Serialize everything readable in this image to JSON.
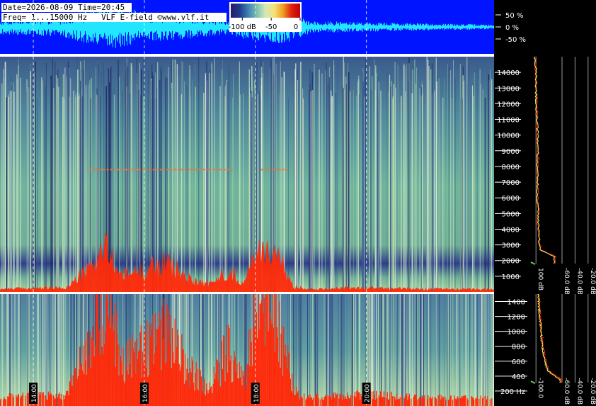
{
  "header": {
    "date_line": "Date=2026-08-09 Time=20:45",
    "freq_line": "Freq= 1...15000 Hz   VLF E-field ©www.vlf.it"
  },
  "colorbar": {
    "ticks": [
      {
        "value": -100,
        "label": "-100 dB"
      },
      {
        "value": -50,
        "label": "-50"
      },
      {
        "value": 0,
        "label": "0"
      }
    ],
    "range_db": [
      -120,
      0
    ],
    "colors": [
      "#2a1a6e",
      "#1c3a8a",
      "#3f7fb5",
      "#7cc0b0",
      "#d4e8b8",
      "#f3e27a",
      "#f0a020",
      "#e02010",
      "#c00000"
    ]
  },
  "colors": {
    "waveform_bg": "#0014ff",
    "waveform_trace": "#22e6ff",
    "burst": "#ff2a0a",
    "grid": "#ffffff",
    "spectrum_red": "#ff2a0a",
    "spectrum_yellow": "#f4f060",
    "spectrum_green": "#5ad250"
  },
  "chart_data": [
    {
      "type": "area",
      "name": "waveform",
      "ylabel_ticks": [
        "50 %",
        "0 %",
        "-50 %"
      ],
      "y_ticks_values": [
        50,
        0,
        -50
      ],
      "ylim": [
        -100,
        100
      ],
      "xlim": [
        13.4,
        22.3
      ],
      "envelope_x": [
        13.4,
        14.5,
        15.0,
        15.5,
        16.0,
        16.5,
        17.0,
        17.5,
        18.0,
        18.5,
        19.0,
        20.0,
        21.0,
        22.3
      ],
      "envelope_pct": [
        30,
        40,
        75,
        90,
        60,
        55,
        45,
        30,
        65,
        70,
        25,
        20,
        15,
        10
      ]
    },
    {
      "type": "heatmap",
      "name": "spectrogram-full",
      "yunit": "Hz",
      "ylim": [
        0,
        15000
      ],
      "y_ticks": [
        1000,
        2000,
        3000,
        4000,
        5000,
        6000,
        7000,
        8000,
        9000,
        10000,
        11000,
        12000,
        13000,
        14000
      ],
      "xlim": [
        13.4,
        22.3
      ],
      "time_markers": [
        {
          "x": 14.0,
          "label": "14:00"
        },
        {
          "x": 16.0,
          "label": "16:00"
        },
        {
          "x": 18.0,
          "label": "18:00"
        },
        {
          "x": 20.0,
          "label": "20:00"
        }
      ],
      "burst_profile_x": [
        13.4,
        14.6,
        15.0,
        15.3,
        15.6,
        16.0,
        16.4,
        16.8,
        17.2,
        17.5,
        17.8,
        18.0,
        18.3,
        18.7,
        19.0,
        20.0,
        21.0,
        22.3
      ],
      "burst_profile_hz": [
        300,
        400,
        2200,
        4300,
        1500,
        2200,
        2800,
        1300,
        700,
        2100,
        800,
        4200,
        4000,
        500,
        300,
        400,
        300,
        250
      ],
      "carrier_lines": [
        {
          "from": 15.0,
          "to": 17.6,
          "freq_hz": 7800
        },
        {
          "from": 18.1,
          "to": 18.6,
          "freq_hz": 7800
        }
      ]
    },
    {
      "type": "heatmap",
      "name": "spectrogram-low",
      "yunit": "Hz",
      "ylim": [
        0,
        1500
      ],
      "y_ticks": [
        200,
        400,
        600,
        800,
        1000,
        1200,
        1400
      ],
      "y_tick_labels": [
        "200 Hz",
        "400",
        "600",
        "800",
        "1000",
        "1200",
        "1400"
      ],
      "xlim": [
        13.4,
        22.3
      ]
    },
    {
      "type": "line",
      "name": "spectrum-full",
      "x_ticks": [
        -100,
        -60,
        -40,
        -20
      ],
      "x_tick_labels": [
        "100 dB",
        "-60.0 dB",
        "-40.0 dB",
        "-20.0 dB"
      ],
      "xlim": [
        -110,
        -10
      ],
      "ylim": [
        0,
        15000
      ],
      "series": [
        {
          "color": "red",
          "freq_hz": [
            500,
            1000,
            1500,
            2000,
            3000,
            4000,
            5000,
            6000,
            7000,
            8000,
            9000,
            10000,
            11000,
            12000,
            13000,
            14000,
            15000
          ],
          "db": [
            -70,
            -92,
            -94,
            -96,
            -97,
            -96,
            -97,
            -98,
            -97,
            -96,
            -98,
            -99,
            -98,
            -99,
            -100,
            -101,
            -101
          ]
        },
        {
          "color": "yellow",
          "freq_hz": [
            500,
            1000,
            1500,
            2000,
            3000,
            4000,
            5000,
            6000,
            7000,
            8000,
            9000,
            10000,
            11000,
            12000,
            13000,
            14000,
            15000
          ],
          "db": [
            -72,
            -93,
            -95,
            -95,
            -96,
            -97,
            -98,
            -97,
            -98,
            -97,
            -97,
            -98,
            -99,
            -100,
            -100,
            -100,
            -102
          ]
        }
      ]
    },
    {
      "type": "line",
      "name": "spectrum-low",
      "x_ticks": [
        -100,
        -60,
        -40,
        -20
      ],
      "x_tick_labels": [
        "-100.0",
        "-60.0 dB",
        "-40.0 dB",
        "-20.0 dB"
      ],
      "xlim": [
        -110,
        -10
      ],
      "ylim": [
        0,
        1500
      ],
      "series": [
        {
          "color": "red",
          "freq_hz": [
            50,
            200,
            400,
            600,
            800,
            1000,
            1200,
            1400,
            1500
          ],
          "db": [
            -60,
            -80,
            -86,
            -89,
            -91,
            -93,
            -94,
            -95,
            -96
          ]
        },
        {
          "color": "yellow",
          "freq_hz": [
            50,
            200,
            400,
            600,
            800,
            1000,
            1200,
            1400,
            1500
          ],
          "db": [
            -63,
            -82,
            -87,
            -90,
            -92,
            -93,
            -95,
            -96,
            -96
          ]
        }
      ]
    }
  ]
}
